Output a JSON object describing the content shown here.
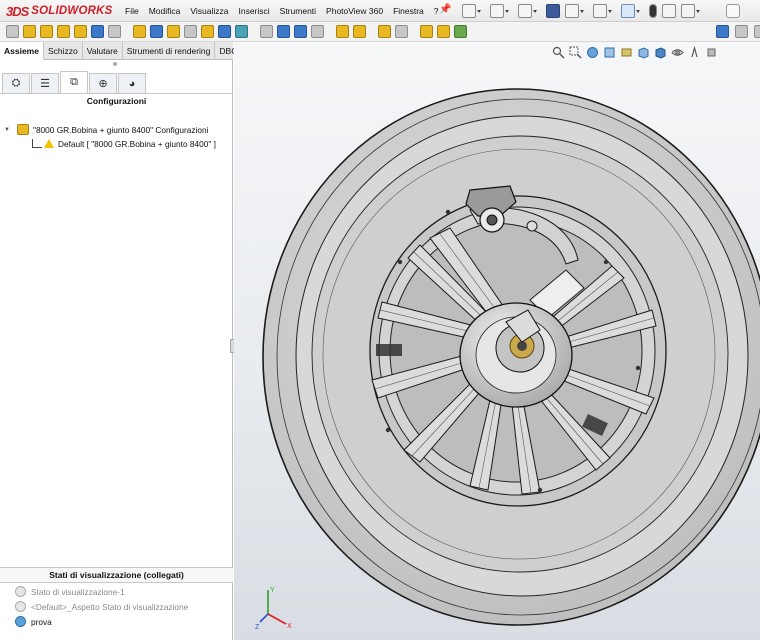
{
  "app": {
    "logo_mark": "3DS",
    "logo_text": "SOLIDWORKS",
    "menus": [
      "File",
      "Modifica",
      "Visualizza",
      "Inserisci",
      "Strumenti",
      "PhotoView 360",
      "Finestra",
      "?"
    ]
  },
  "command_tabs": [
    "Assieme",
    "Schizzo",
    "Valutare",
    "Strumenti di rendering",
    "DBCent"
  ],
  "active_command_tab": "Assieme",
  "panel_tabs": [
    {
      "name": "featuremanager",
      "glyph": "⛭"
    },
    {
      "name": "propertymanager",
      "glyph": "☰"
    },
    {
      "name": "configurationmanager",
      "glyph": "⧉"
    },
    {
      "name": "dimxpertmanager",
      "glyph": "⊕"
    },
    {
      "name": "displaymanager",
      "glyph": "◕"
    }
  ],
  "configuration_panel": {
    "header": "Configurazioni",
    "root": "\"8000 GR.Bobina + giunto 8400\" Configurazioni",
    "child": "Default [ \"8000 GR.Bobina + giunto 8400\" ]"
  },
  "display_states": {
    "header": "Stati di visualizzazione (collegati)",
    "items": [
      {
        "label": "Stato di visualizzazione-1",
        "active": false
      },
      {
        "label": "<Default>_Aspetto Stato di visualizzazione",
        "active": false
      },
      {
        "label": "prova",
        "active": true
      }
    ]
  },
  "triad": {
    "x": "X",
    "y": "Y",
    "z": "Z"
  },
  "colors": {
    "brand_red": "#d01f28",
    "viewport_bg": "#e8ebef",
    "model_fill": "#cfcfcf",
    "model_edge": "#1a1a1a",
    "accent_blue": "#3d79c9"
  }
}
